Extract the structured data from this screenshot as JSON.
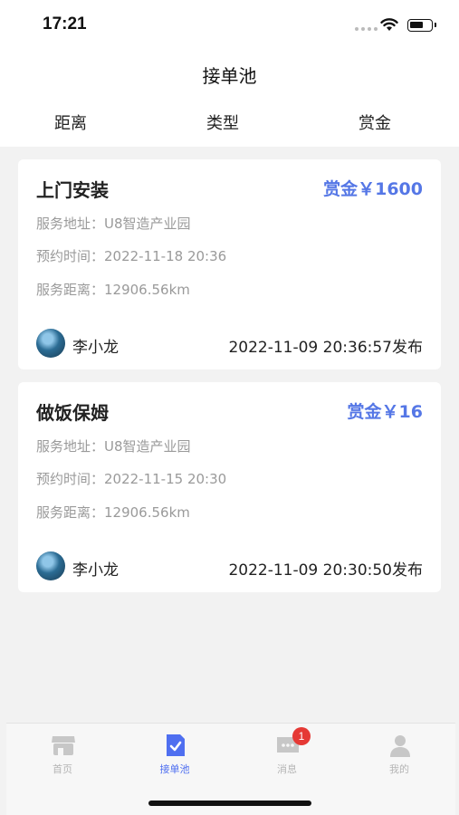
{
  "status_bar": {
    "time": "17:21"
  },
  "header": {
    "title": "接单池"
  },
  "filters": [
    "距离",
    "类型",
    "赏金"
  ],
  "orders": [
    {
      "title": "上门安装",
      "reward": "赏金￥1600",
      "address": "服务地址：U8智造产业园",
      "appointment": "预约时间：2022-11-18 20:36",
      "distance": "服务距离：12906.56km",
      "author": "李小龙",
      "posted": "2022-11-09 20:36:57发布"
    },
    {
      "title": "做饭保姆",
      "reward": "赏金￥16",
      "address": "服务地址：U8智造产业园",
      "appointment": "预约时间：2022-11-15 20:30",
      "distance": "服务距离：12906.56km",
      "author": "李小龙",
      "posted": "2022-11-09 20:30:50发布"
    }
  ],
  "tabbar": {
    "tabs": [
      {
        "label": "首页",
        "icon": "shop-icon"
      },
      {
        "label": "接单池",
        "icon": "checklist-icon",
        "active": true
      },
      {
        "label": "消息",
        "icon": "message-icon",
        "badge": "1"
      },
      {
        "label": "我的",
        "icon": "user-icon"
      }
    ]
  },
  "colors": {
    "accent": "#5577e6",
    "tab_active": "#4f6ff0",
    "badge": "#e53935",
    "muted": "#9a9a9a"
  }
}
